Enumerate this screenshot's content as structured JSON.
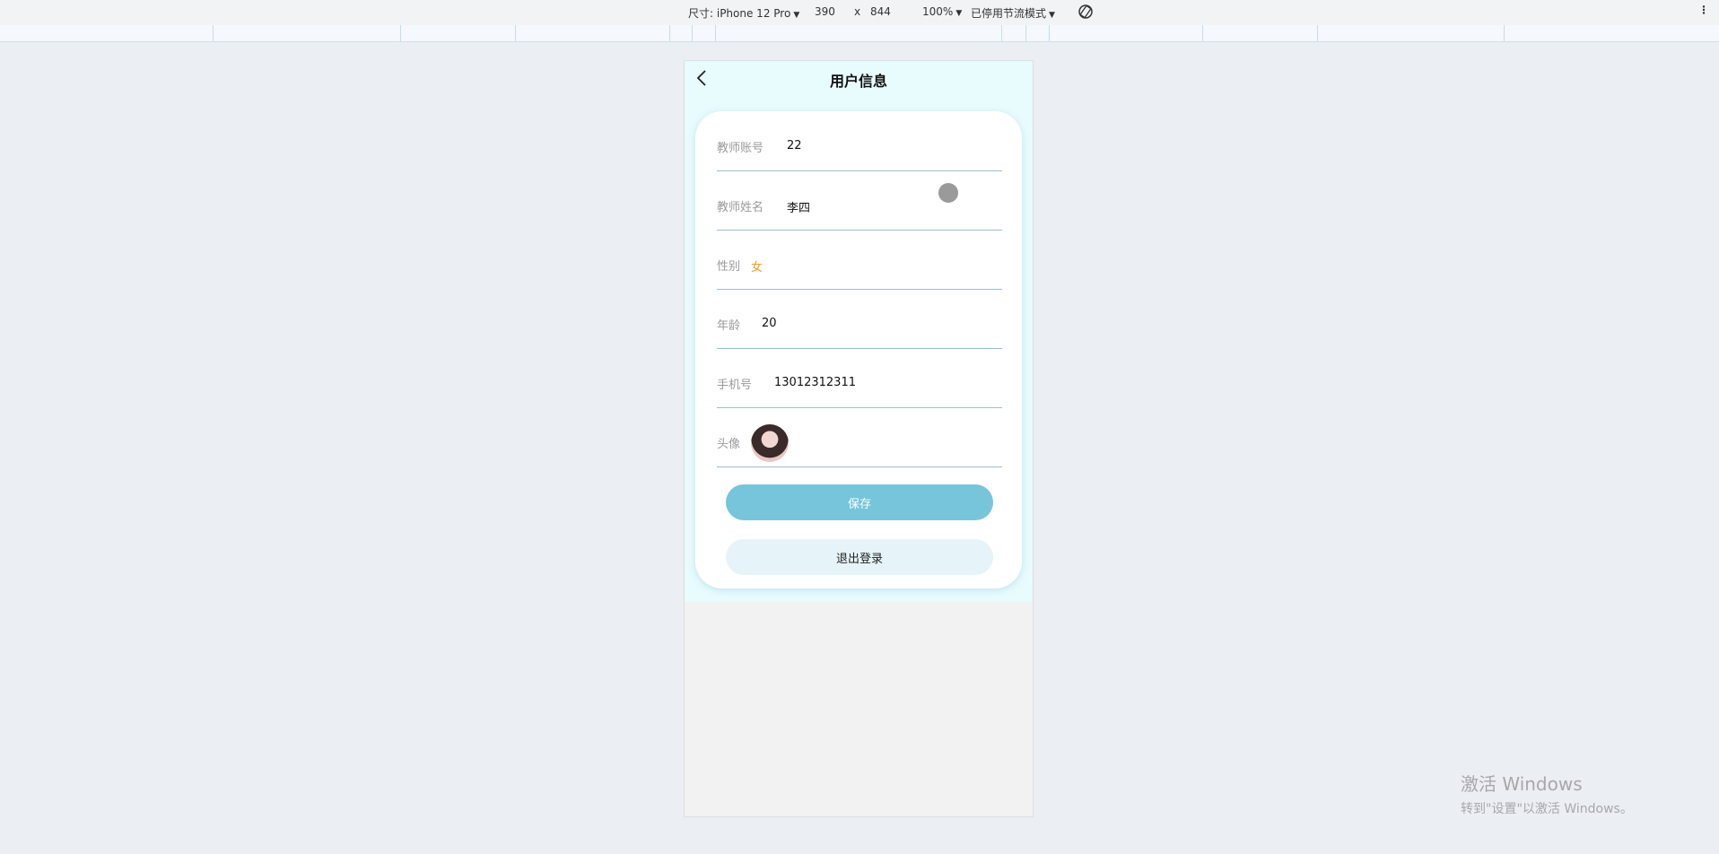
{
  "toolbar": {
    "device_label": "尺寸: iPhone 12 Pro",
    "width_value": "390",
    "times_sign": "x",
    "height_value": "844",
    "zoom": "100%",
    "throttle": "已停用节流模式"
  },
  "page": {
    "title": "用户信息",
    "fields": [
      {
        "label": "教师账号",
        "value": "22"
      },
      {
        "label": "教师姓名",
        "value": "李四"
      },
      {
        "label": "性别",
        "value": "女"
      },
      {
        "label": "年龄",
        "value": "20"
      },
      {
        "label": "手机号",
        "value": "13012312311"
      },
      {
        "label": "头像"
      }
    ],
    "save_label": "保存",
    "logout_label": "退出登录"
  },
  "watermark": {
    "line1": "激活 Windows",
    "line2": "转到\"设置\"以激活 Windows。"
  },
  "colors": {
    "accent": "#76c5da",
    "gender_value": "#f0a020"
  }
}
